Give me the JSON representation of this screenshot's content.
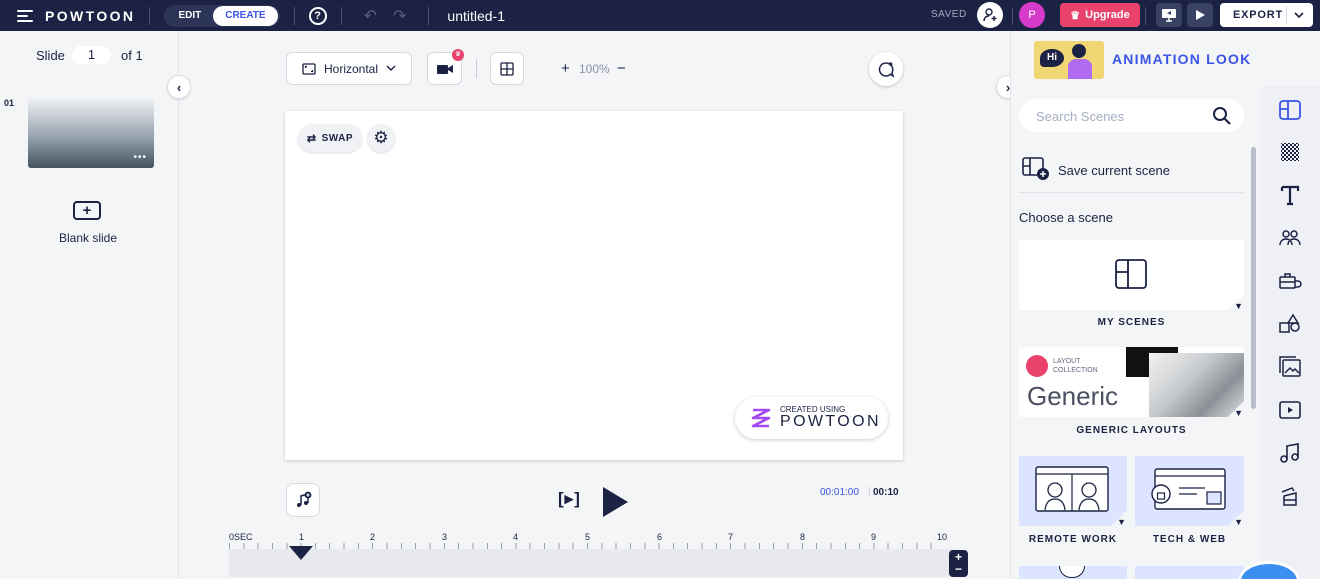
{
  "topbar": {
    "logo": "POWTOON",
    "mode_edit": "EDIT",
    "mode_create": "CREATE",
    "help": "?",
    "doc_title": "untitled-1",
    "saved": "SAVED",
    "avatar_letter": "P",
    "upgrade": "Upgrade",
    "export": "EXPORT"
  },
  "slides": {
    "label": "Slide",
    "current": "1",
    "of": "of 1",
    "thumb_number": "01",
    "thumb_menu": "•••",
    "blank": "Blank slide"
  },
  "toolbar": {
    "orientation": "Horizontal",
    "zoom": "100%",
    "plus": "+",
    "minus": "−"
  },
  "canvas": {
    "swap": "SWAP",
    "watermark_small": "CREATED USING",
    "watermark_big": "POWTOON"
  },
  "player": {
    "play_slide": "[▸]",
    "current_time": "00:01:00",
    "total_time": "00:10"
  },
  "timeline": {
    "labels": [
      "0SEC",
      "1",
      "2",
      "3",
      "4",
      "5",
      "6",
      "7",
      "8",
      "9",
      "10"
    ]
  },
  "right_panel": {
    "title": "ANIMATION LOOK",
    "bubble": "Hi",
    "search_placeholder": "Search Scenes",
    "save_scene": "Save current scene",
    "choose": "Choose a scene",
    "layout_small_1": "LAYOUT",
    "layout_small_2": "COLLECTION",
    "generic_big": "Generic",
    "scenes": [
      "MY SCENES",
      "GENERIC LAYOUTS",
      "REMOTE WORK",
      "TECH & WEB"
    ]
  },
  "colors": {
    "navy": "#1b2243",
    "accent_blue": "#3b55e6",
    "upgrade": "#e9426d",
    "avatar": "#d63ac9",
    "scene_bg": "#dde4ff"
  }
}
